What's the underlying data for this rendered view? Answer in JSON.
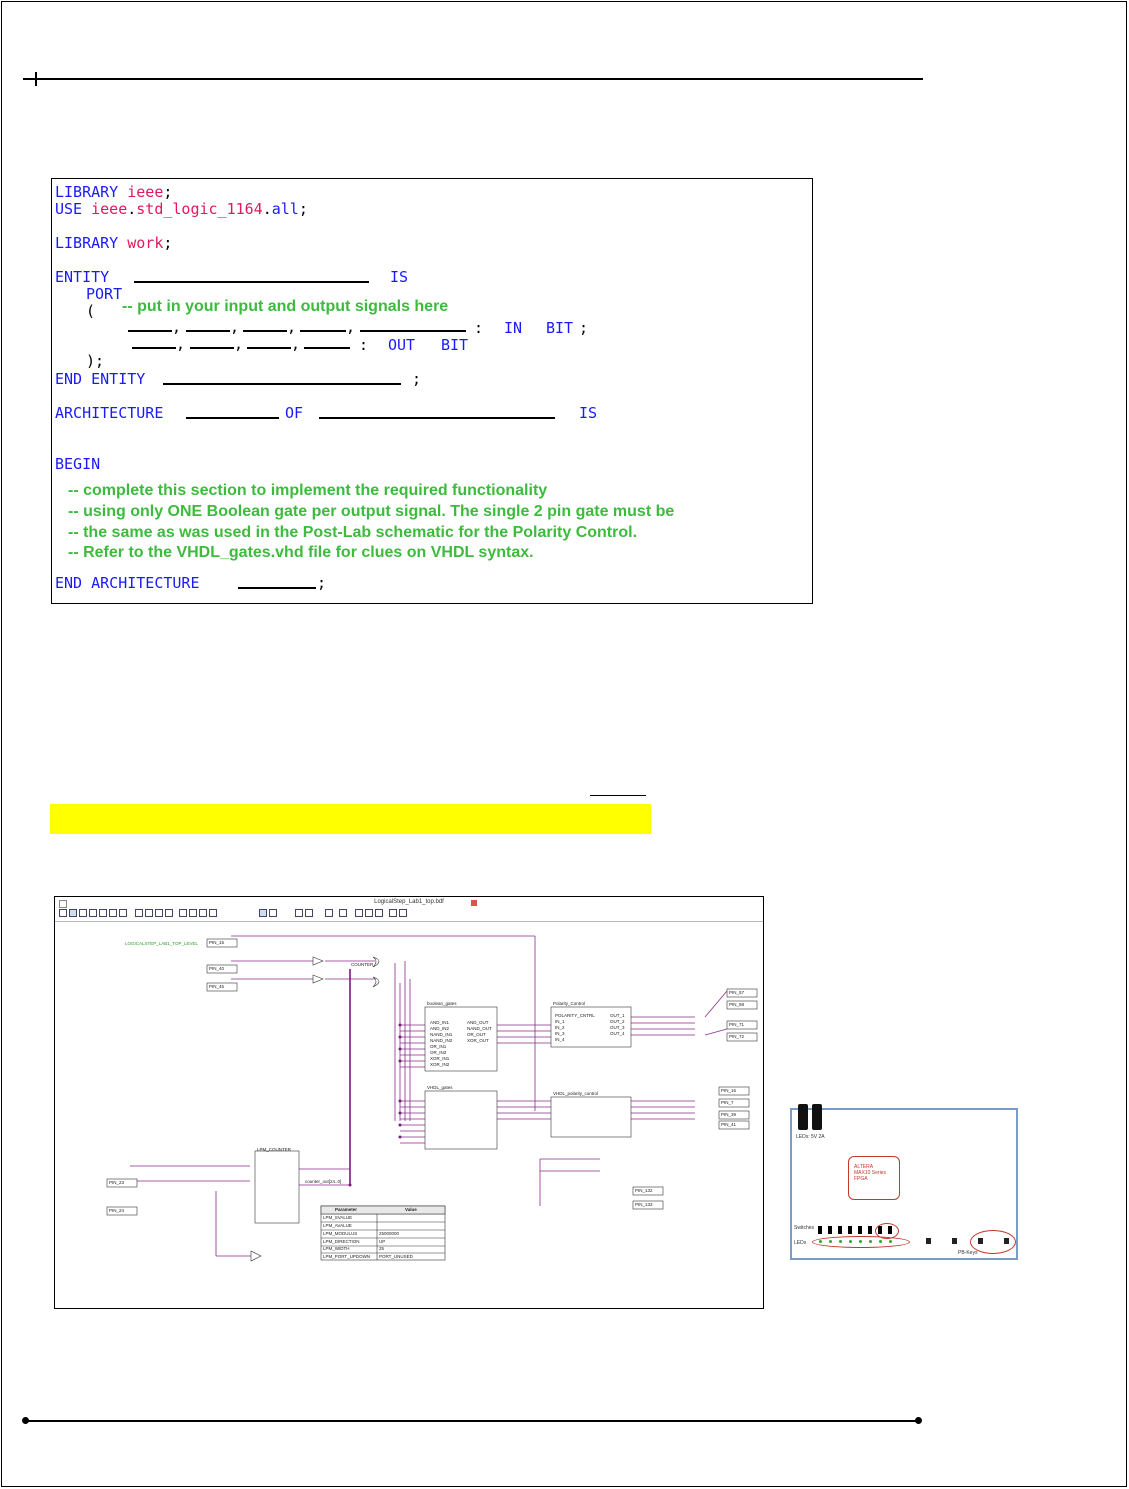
{
  "code": {
    "line1": "LIBRARY ieee;",
    "line1_kw": "LIBRARY",
    "line1_lib": "ieee",
    "line2_kw": "USE",
    "line2_lib": "ieee",
    "line2_pkg": "std_logic_1164",
    "line2_all": "all",
    "line3_kw": "LIBRARY",
    "line3_lib": "work",
    "entity_kw": "ENTITY",
    "is_kw": "IS",
    "port_kw": "PORT",
    "open_paren": "(",
    "port_comment": "-- put in your input and output signals here",
    "in_kw": "IN",
    "bit_type": "BIT",
    "out_kw": "OUT",
    "close_paren": ");",
    "end_entity_kw": "END ENTITY",
    "arch_kw": "ARCHITECTURE",
    "of_kw": "OF",
    "begin_kw": "BEGIN",
    "comments": [
      "-- complete this section to implement the required functionality",
      "-- using only ONE Boolean gate per output signal. The single 2 pin gate must be",
      "-- the same as was used in the Post-Lab schematic for the Polarity Control.",
      "-- Refer to the VHDL_gates.vhd file for clues on VHDL syntax."
    ],
    "end_arch_kw": "END ARCHITECTURE"
  },
  "schematic": {
    "window_title": "LogicalStep_Lab1_top.bdf",
    "top_label": "LOGICALSTEP_LAB1_TOP_LEVEL",
    "block_boolean": "boolean_gates",
    "block_polarity": "Polarity_Control",
    "block_vhdl_gates": "VHDL_gates",
    "block_vhdl_polarity": "VHDL_polarity_control",
    "block_counter": "LPM_COUNTER",
    "boolean_inputs": [
      "AND_IN1",
      "AND_IN2",
      "NAND_IN1",
      "NAND_IN2",
      "OR_IN1",
      "OR_IN2",
      "XOR_IN1",
      "XOR_IN2"
    ],
    "boolean_outputs": [
      "AND_OUT",
      "NAND_OUT",
      "OR_OUT",
      "XOR_OUT"
    ],
    "polarity_inputs": [
      "POLARITY_CNTRL",
      "IN_1",
      "IN_2",
      "IN_3",
      "IN_4"
    ],
    "polarity_outputs": [
      "OUT_1",
      "OUT_2",
      "OUT_3",
      "OUT_4"
    ],
    "param_table": {
      "headers": [
        "Parameter",
        "Value"
      ],
      "rows": [
        [
          "LPM_SVALUE",
          ""
        ],
        [
          "LPM_AVALUE",
          ""
        ],
        [
          "LPM_MODULUS",
          "25000000"
        ],
        [
          "LPM_DIRECTION",
          "UP"
        ],
        [
          "LPM_WIDTH",
          "25"
        ],
        [
          "LPM_PORT_UPDOWN",
          "PORT_UNUSED"
        ]
      ]
    },
    "pins_left": [
      "PIN_15",
      "PIN_40",
      "PIN_45"
    ],
    "pins_counter": [
      "PIN_23",
      "PIN_24"
    ],
    "pins_right_top": [
      "PIN_57",
      "PIN_58",
      "PIN_71",
      "PIN_72"
    ],
    "pins_right_mid": [
      "PIN_16",
      "PIN_7",
      "PIN_39",
      "PIN_41"
    ],
    "pins_right_bottom": [
      "PIN_132",
      "PIN_133"
    ],
    "counter_label": "COUNTER",
    "counter_out": "counter_out[24..0]"
  },
  "board": {
    "battery_label": "LEDs: 5V 2A",
    "chip_text": "ALTERA\nMAX10 Series\nFPGA",
    "switches_label": "Switches",
    "leds_label": "LEDs",
    "pb_label": "PB-Keys"
  }
}
